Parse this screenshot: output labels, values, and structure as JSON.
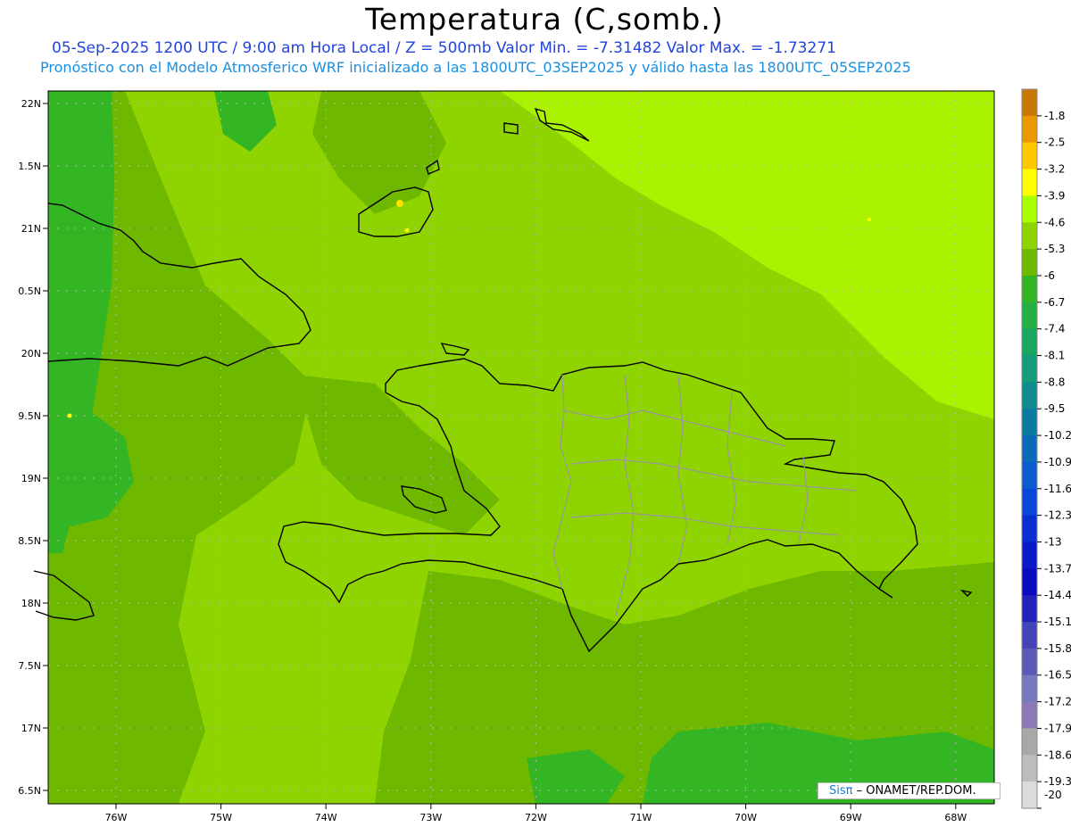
{
  "header": {
    "title": "Temperatura (C,somb.)",
    "line1": "05-Sep-2025  1200 UTC / 9:00 am Hora Local / Z = 500mb  Valor Min. = -7.31482  Valor Max. = -1.73271",
    "line2": "Pronóstico con el Modelo Atmosferico WRF inicializado a las 1800UTC_03SEP2025 y válido hasta las  1800UTC_05SEP2025"
  },
  "map": {
    "lat_labels": [
      "22N",
      "1.5N",
      "21N",
      "0.5N",
      "20N",
      "9.5N",
      "19N",
      "8.5N",
      "18N",
      "7.5N",
      "17N",
      "6.5N"
    ],
    "lon_labels": [
      "76W",
      "75W",
      "74W",
      "73W",
      "72W",
      "71W",
      "70W",
      "69W",
      "68W"
    ],
    "colors": {
      "base": "#8fd400",
      "darker": "#6eb800",
      "darkest": "#33b524",
      "lighter": "#aaf200",
      "coast": "#000000",
      "border": "#999999",
      "grid": "#b5b5b5"
    }
  },
  "legend": {
    "labels": [
      "-1.8",
      "-2.5",
      "-3.2",
      "-3.9",
      "-4.6",
      "-5.3",
      "-6",
      "-6.7",
      "-7.4",
      "-8.1",
      "-8.8",
      "-9.5",
      "-10.2",
      "-10.9",
      "-11.6",
      "-12.3",
      "-13",
      "-13.7",
      "-14.4",
      "-15.1",
      "-15.8",
      "-16.5",
      "-17.2",
      "-17.9",
      "-18.6",
      "-19.3",
      "-20"
    ],
    "colors": [
      "#c87800",
      "#e89a00",
      "#ffc800",
      "#ffff00",
      "#aaff00",
      "#8fd400",
      "#6eb800",
      "#33b524",
      "#24b043",
      "#1aa560",
      "#149d7a",
      "#108c8c",
      "#0a7aa0",
      "#0a6ab8",
      "#0a5ad0",
      "#0a46d8",
      "#0a2ed0",
      "#0a1ac8",
      "#0a0ac0",
      "#2222b8",
      "#4444b8",
      "#5a5ab8",
      "#7878c0",
      "#8c7ab8",
      "#a8a8a8",
      "#bcbcbc",
      "#dcdcdc"
    ]
  },
  "credit": {
    "brand": "Sisπ",
    "org": "– ONAMET/REP.DOM."
  }
}
